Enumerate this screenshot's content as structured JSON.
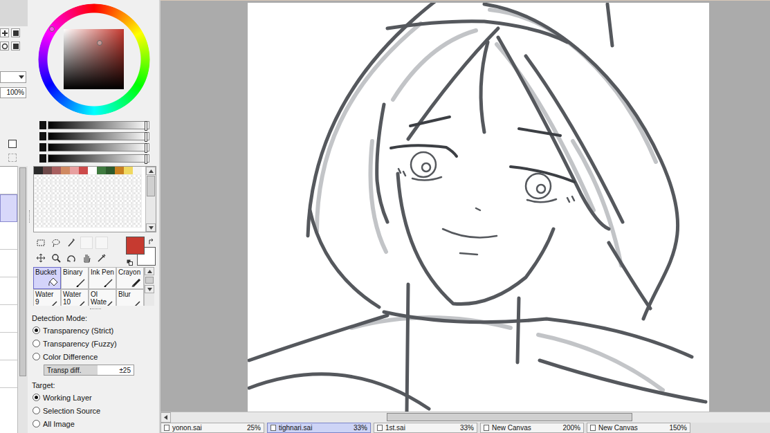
{
  "layer_panel": {
    "opacity": "100%",
    "layers": [
      {
        "selected": false
      },
      {
        "selected": true
      },
      {
        "selected": false
      },
      {
        "selected": false
      },
      {
        "selected": false
      },
      {
        "selected": false
      },
      {
        "selected": false
      },
      {
        "selected": false
      }
    ]
  },
  "color_picker": {
    "hue": 0.85,
    "saturation": 0.6,
    "value": 0.77,
    "primary": "#c63a30",
    "secondary": "#ffffff"
  },
  "sliders": [
    {
      "level": 0.97
    },
    {
      "level": 0.97
    },
    {
      "level": 0.97
    },
    {
      "level": 0.97
    }
  ],
  "swatches": [
    {
      "color": "#2a2a2a"
    },
    {
      "color": "#6e4a4a"
    },
    {
      "color": "#a86060"
    },
    {
      "color": "#d08a62"
    },
    {
      "color": "#e8a0a0"
    },
    {
      "color": "#cc4a4a"
    },
    {
      "color": "#ffffff"
    },
    {
      "color": "#3f7a3f"
    },
    {
      "color": "#2c5a2c"
    },
    {
      "color": "#c98020"
    },
    {
      "color": "#f0d860"
    },
    {
      "color": "#f4f4f4"
    }
  ],
  "tools": [
    {
      "label": "Bucket",
      "kind": "bucket",
      "selected": true
    },
    {
      "label": "Binary",
      "kind": "pen",
      "selected": false
    },
    {
      "label": "Ink Pen",
      "kind": "pen",
      "selected": false
    },
    {
      "label": "Crayon",
      "kind": "crayon",
      "selected": false
    },
    {
      "label": "Water\n9",
      "kind": "pen",
      "selected": false
    },
    {
      "label": "Water\n10",
      "kind": "pen",
      "selected": false
    },
    {
      "label": "Ol Wate",
      "kind": "pen",
      "selected": false
    },
    {
      "label": "Blur",
      "kind": "pen",
      "selected": false
    }
  ],
  "detection_mode": {
    "title": "Detection Mode:",
    "options": [
      {
        "label": "Transparency (Strict)",
        "selected": true
      },
      {
        "label": "Transparency (Fuzzy)",
        "selected": false
      },
      {
        "label": "Color Difference",
        "selected": false
      }
    ],
    "field": {
      "label": "Transp diff.",
      "value": "±25"
    }
  },
  "target": {
    "title": "Target:",
    "options": [
      {
        "label": "Working Layer",
        "selected": true
      },
      {
        "label": "Selection Source",
        "selected": false
      },
      {
        "label": "All Image",
        "selected": false
      }
    ]
  },
  "horizontal_scroll": {
    "start": 0.36,
    "level": 0.41
  },
  "documents": [
    {
      "name": "yonon.sai",
      "zoom": "25%",
      "selected": false
    },
    {
      "name": "tighnari.sai",
      "zoom": "33%",
      "selected": true
    },
    {
      "name": "1st.sai",
      "zoom": "33%",
      "selected": false
    },
    {
      "name": "New Canvas",
      "zoom": "200%",
      "selected": false
    },
    {
      "name": "New Canvas",
      "zoom": "150%",
      "selected": false
    }
  ]
}
